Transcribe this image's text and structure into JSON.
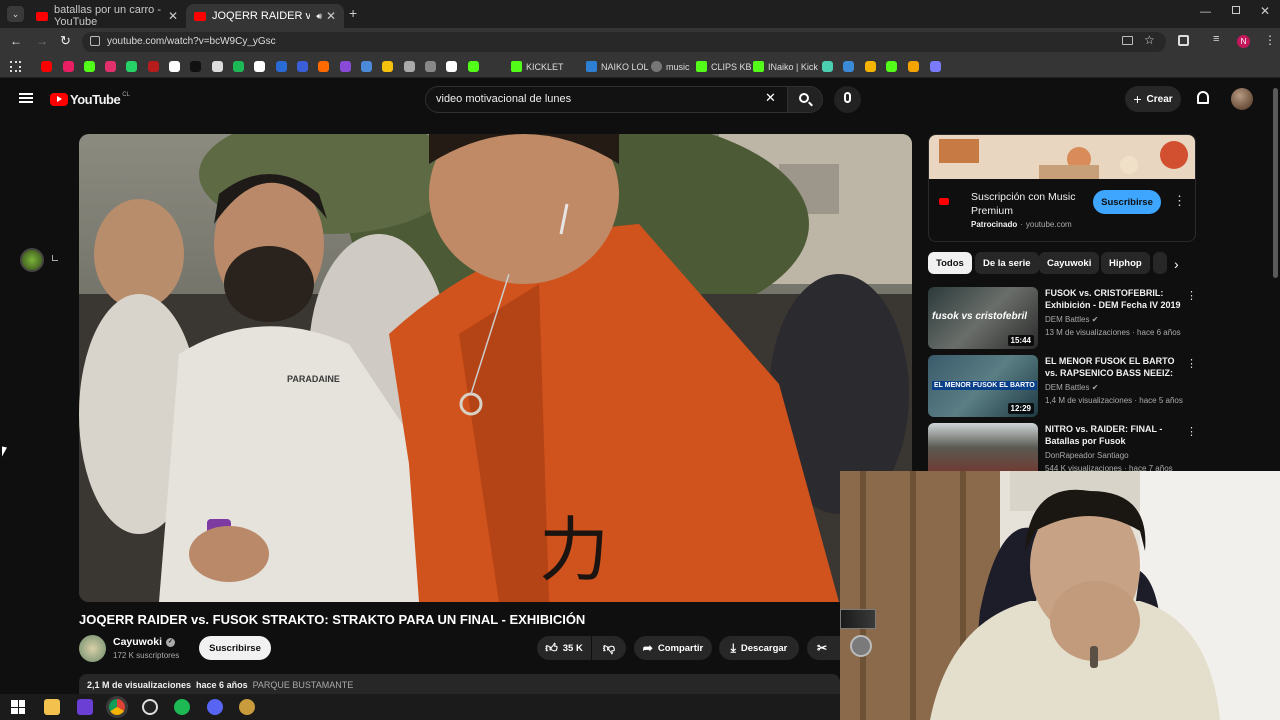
{
  "browser": {
    "tabs": [
      {
        "title": "batallas por un carro - YouTube",
        "active": false
      },
      {
        "title": "JOQERR RAIDER vs. FUSOK",
        "active": true
      }
    ],
    "url": "youtube.com/watch?v=bcW9Cy_yGsc",
    "bookmarks": [
      "KICKLET",
      "NAIKO LOL",
      "music",
      "CLIPS KB",
      "INaiko | Kick"
    ]
  },
  "youtube": {
    "logo_text": "YouTube",
    "logo_country": "CL",
    "search_value": "video motivacional de lunes",
    "create_label": "Crear"
  },
  "video": {
    "title": "JOQERR RAIDER vs. FUSOK STRAKTO: STRAKTO PARA UN FINAL - EXHIBICIÓN",
    "channel": "Cayuwoki",
    "subscribers": "172 K suscriptores",
    "subscribe_label": "Suscribirse",
    "likes": "35 K",
    "share_label": "Compartir",
    "download_label": "Descargar",
    "views": "2,1 M de visualizaciones",
    "age": "hace 6 años",
    "location": "PARQUE BUSTAMANTE",
    "shirt_text": "PARADAINE",
    "overlay_text": "力"
  },
  "sponsor": {
    "title": "Suscripción con Music Premium",
    "label": "Patrocinado",
    "domain": "youtube.com",
    "button": "Suscribirse"
  },
  "chips": [
    "Todos",
    "De la serie",
    "Cayuwoki",
    "Hiphop"
  ],
  "recommendations": [
    {
      "title": "FUSOK vs. CRISTOFEBRIL: Exhibición - DEM Fecha IV 2019",
      "channel": "DEM Battles",
      "views": "13 M de visualizaciones",
      "age": "hace 6 años",
      "duration": "15:44",
      "thumb_text": "fusok vs cristofebril",
      "verified": true
    },
    {
      "title": "EL MENOR FUSOK EL BARTO vs. RAPSENICO BASS NEEIZ: ...",
      "channel": "DEM Battles",
      "views": "1,4 M de visualizaciones",
      "age": "hace 5 años",
      "duration": "12:29",
      "thumb_text": "EL MENOR FUSOK EL BARTO",
      "verified": true
    },
    {
      "title": "NITRO vs. RAIDER: FINAL - Batallas por Fusok",
      "channel": "DonRapeador Santiago",
      "views": "544 K visualizaciones",
      "age": "hace 7 años",
      "duration": "",
      "thumb_text": "",
      "verified": false
    }
  ]
}
